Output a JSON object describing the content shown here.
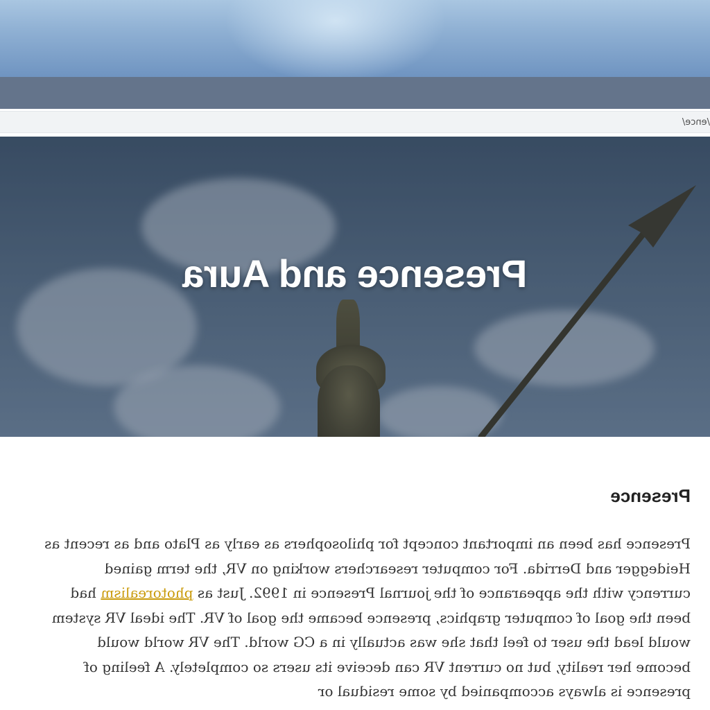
{
  "address_bar": {
    "url_text": "/ence/"
  },
  "hero": {
    "title": "Presence and Aura"
  },
  "article": {
    "section_heading": "Presence",
    "paragraph_before_link": "Presence has been an important concept for philosophers as early as Plato and as recent as Heidegger and Derrida. For computer researchers working on VR, the term gained currency with the appearance of the journal Presence in 1992. Just as ",
    "link_text": "photorealism",
    "paragraph_after_link": " had been the goal of computer graphics, presence became the goal of VR. The ideal VR system would lead the user to feel that she was actually in a CG world. The VR world would become her reality, but no current VR can deceive its users so completely. A feeling of presence is always accompanied by some residual or"
  }
}
